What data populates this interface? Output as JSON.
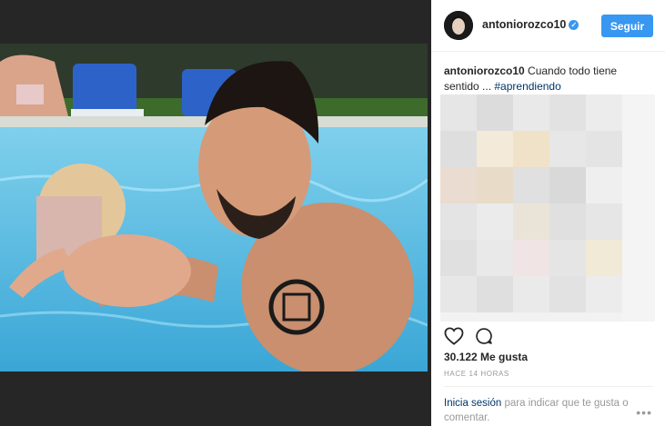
{
  "post": {
    "username": "antoniorozco10",
    "follow_label": "Seguir",
    "caption_user": "antoniorozco10",
    "caption_text": " Cuando todo tiene sentido ... ",
    "caption_tag": "#aprendiendo",
    "likes": "30.122 Me gusta",
    "time": "HACE 14 HORAS",
    "login_link": "Inicia sesión",
    "login_text": " para indicar que te gusta o comentar.",
    "more_label": "•••"
  },
  "icons": [
    "verified-badge-icon",
    "heart-icon",
    "comment-icon",
    "more-options-icon"
  ],
  "colors": {
    "accent": "#3897f0",
    "link": "#003569",
    "muted": "#999999"
  }
}
